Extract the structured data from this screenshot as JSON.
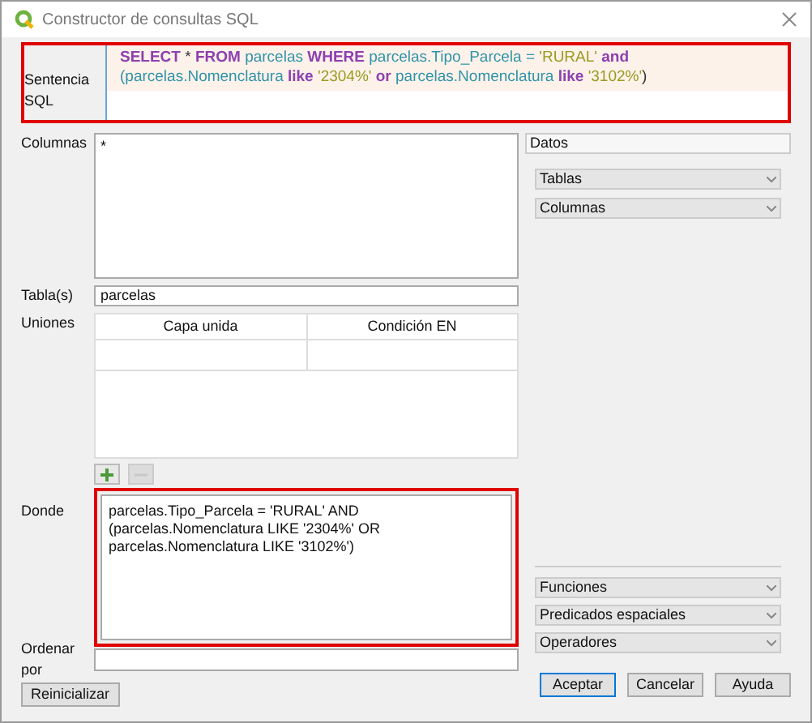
{
  "window": {
    "title": "Constructor de consultas SQL"
  },
  "sql": {
    "label": "Sentencia SQL",
    "highlighted": true,
    "tokens": [
      {
        "text": "SELECT",
        "kind": "keyword"
      },
      {
        "text": " * ",
        "kind": "operator"
      },
      {
        "text": "FROM",
        "kind": "keyword"
      },
      {
        "text": " parcelas ",
        "kind": "identifier"
      },
      {
        "text": "WHERE",
        "kind": "keyword"
      },
      {
        "text": " parcelas.Tipo_Parcela = ",
        "kind": "identifier"
      },
      {
        "text": "'RURAL'",
        "kind": "string"
      },
      {
        "text": " and ",
        "kind": "keyword"
      },
      {
        "text": "(parcelas.Nomenclatura ",
        "kind": "identifier"
      },
      {
        "text": "like",
        "kind": "keyword"
      },
      {
        "text": " '2304%'",
        "kind": "string"
      },
      {
        "text": " or ",
        "kind": "keyword"
      },
      {
        "text": "parcelas.Nomenclatura ",
        "kind": "identifier"
      },
      {
        "text": "like",
        "kind": "keyword"
      },
      {
        "text": " '3102%'",
        "kind": "string"
      },
      {
        "text": ")",
        "kind": "operator"
      }
    ]
  },
  "columns": {
    "label": "Columnas",
    "value": "*"
  },
  "tables": {
    "label": "Tabla(s)",
    "value": "parcelas"
  },
  "joins": {
    "label": "Uniones",
    "headers": [
      "Capa unida",
      "Condición EN"
    ],
    "add_enabled": true,
    "remove_enabled": false
  },
  "where": {
    "label": "Donde",
    "highlighted": true,
    "value": "parcelas.Tipo_Parcela = 'RURAL' AND (parcelas.Nomenclatura LIKE '2304%' OR parcelas.Nomenclatura LIKE '3102%')"
  },
  "order_by": {
    "label": "Ordenar por"
  },
  "data_panel": {
    "title": "Datos",
    "dropdowns": [
      "Tablas",
      "Columnas"
    ]
  },
  "lower_dropdowns": [
    "Funciones",
    "Predicados espaciales",
    "Operadores"
  ],
  "reset_button": "Reinicializar",
  "buttons": [
    "Aceptar",
    "Cancelar",
    "Ayuda"
  ]
}
